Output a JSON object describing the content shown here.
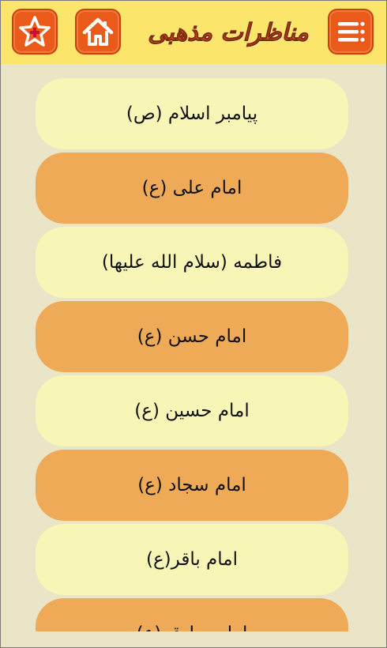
{
  "header": {
    "title": "مناظرات مذهبی",
    "icons": {
      "favorites": "star-plus-icon",
      "home": "home-icon",
      "menu": "menu-list-icon"
    },
    "colors": {
      "bar": "#fbe56a",
      "button": "#ea5a1a",
      "title": "#d9531c"
    }
  },
  "list": {
    "items": [
      {
        "label": "پیامبر اسلام (ص)"
      },
      {
        "label": "امام علی (ع)"
      },
      {
        "label": "فاطمه (سلام الله علیها)"
      },
      {
        "label": "امام حسن (ع)"
      },
      {
        "label": "امام حسین (ع)"
      },
      {
        "label": "امام سجاد (ع)"
      },
      {
        "label": "امام باقر(ع)"
      },
      {
        "label": "امام صادق (ع)"
      }
    ],
    "colors": {
      "light": "#f8f6b6",
      "dark": "#efaa58"
    }
  }
}
